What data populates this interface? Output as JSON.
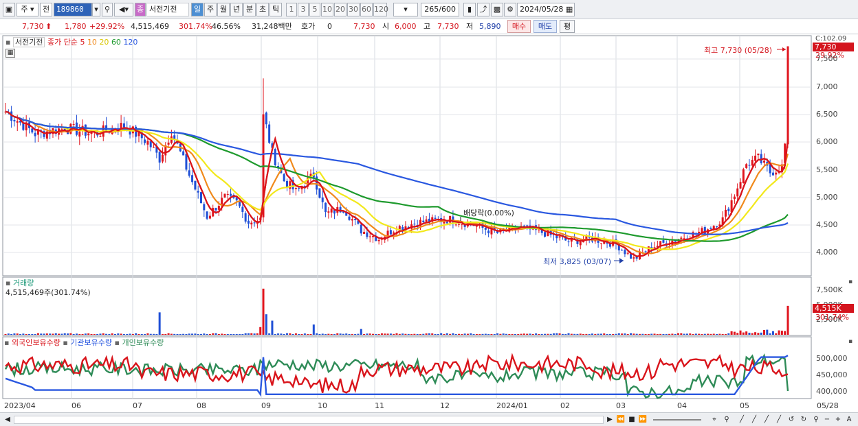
{
  "toolbar": {
    "market": "주",
    "scope": "전",
    "code": "189860",
    "stock_name": "서전기전",
    "periods": [
      "일",
      "주",
      "월",
      "년",
      "분",
      "초",
      "틱"
    ],
    "active_period": "일",
    "intervals": [
      "1",
      "3",
      "5",
      "10",
      "20",
      "30",
      "60",
      "120"
    ],
    "count": "265",
    "count_total": "/600",
    "date": "2024/05/28"
  },
  "quote": {
    "price": "7,730",
    "change": "1,780",
    "change_pct": "+29.92%",
    "volume": "4,515,469",
    "volume_ratio": "301.74%",
    "turnover": "46.56%",
    "amount": "31,248백만",
    "hoga_label": "호가",
    "hoga_value": "0",
    "hoga_price": "7,730",
    "open_label": "시",
    "open": "6,000",
    "high_label": "고",
    "high": "7,730",
    "low_label": "저",
    "low": "5,890",
    "buy_label": "매수",
    "sell_label": "매도",
    "avg_label": "평"
  },
  "price_panel": {
    "title": "서전기전",
    "ma_label": "종가 단순",
    "ma_periods": [
      "5",
      "10",
      "20",
      "60",
      "120"
    ],
    "ma_colors": [
      "#d9141b",
      "#f08a1c",
      "#f2e81b",
      "#1e9a2d",
      "#2a58e0"
    ],
    "high_note": "최고 7,730 (05/28)",
    "low_note": "최저 3,825 (03/07)",
    "dividend_note": "배당락(0.00%)",
    "last_price_tag": "7,730",
    "last_pct_tag": "29.92%",
    "top_tag": "C:102.09",
    "yticks": [
      "7,500",
      "7,000",
      "6,500",
      "6,000",
      "5,500",
      "5,000",
      "4,500",
      "4,000"
    ]
  },
  "volume_panel": {
    "title": "거래량",
    "value": "4,515,469주(301.74%)",
    "yticks": [
      "7,500K",
      "5,000K",
      "2,500K"
    ],
    "tag_value": "4,515K",
    "tag_pct": "301.74%"
  },
  "holdings_panel": {
    "series_labels": [
      "외국인보유수량",
      "기관보유수량",
      "개인보유수량"
    ],
    "series_colors": [
      "#d9141b",
      "#2a58e0",
      "#2e8b57"
    ],
    "yticks": [
      "500,000",
      "450,000",
      "400,000"
    ]
  },
  "xaxis": {
    "labels": [
      "2023/04",
      "06",
      "07",
      "08",
      "09",
      "10",
      "11",
      "12",
      "2024/01",
      "02",
      "03",
      "04",
      "05"
    ],
    "last_label": "05/28"
  },
  "chart_data": {
    "type": "candlestick",
    "title": "서전기전",
    "ylim": [
      3700,
      8000
    ],
    "high": 7730,
    "low": 3825,
    "moving_averages": [
      "5",
      "10",
      "20",
      "60",
      "120"
    ]
  }
}
